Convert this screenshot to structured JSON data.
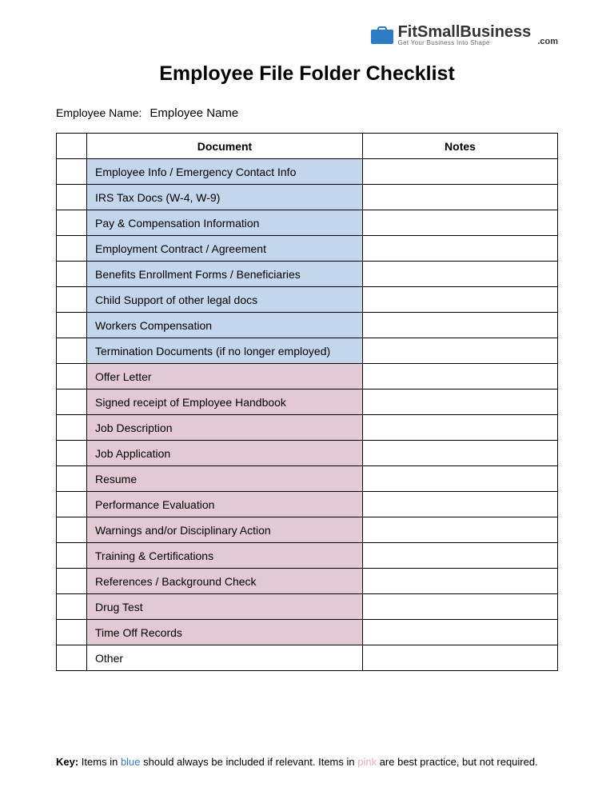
{
  "logo": {
    "brand_fit": "Fit",
    "brand_small": "Small",
    "brand_business": "Business",
    "tagline": "Get Your Business Into Shape",
    "dotcom": ".com"
  },
  "title": "Employee File Folder Checklist",
  "employee_name_label": "Employee Name:",
  "employee_name_value": "Employee Name",
  "headers": {
    "document": "Document",
    "notes": "Notes"
  },
  "rows": [
    {
      "doc": "Employee Info / Emergency Contact Info",
      "color": "blue"
    },
    {
      "doc": "IRS Tax Docs (W-4, W-9)",
      "color": "blue"
    },
    {
      "doc": "Pay & Compensation Information",
      "color": "blue"
    },
    {
      "doc": "Employment Contract / Agreement",
      "color": "blue"
    },
    {
      "doc": "Benefits Enrollment Forms / Beneficiaries",
      "color": "blue"
    },
    {
      "doc": "Child Support of other legal docs",
      "color": "blue"
    },
    {
      "doc": "Workers Compensation",
      "color": "blue"
    },
    {
      "doc": "Termination Documents (if no longer employed)",
      "color": "blue"
    },
    {
      "doc": "Offer Letter",
      "color": "pink"
    },
    {
      "doc": "Signed receipt of Employee Handbook",
      "color": "pink"
    },
    {
      "doc": "Job Description",
      "color": "pink"
    },
    {
      "doc": "Job Application",
      "color": "pink"
    },
    {
      "doc": "Resume",
      "color": "pink"
    },
    {
      "doc": "Performance Evaluation",
      "color": "pink"
    },
    {
      "doc": "Warnings and/or Disciplinary Action",
      "color": "pink"
    },
    {
      "doc": "Training & Certifications",
      "color": "pink"
    },
    {
      "doc": "References / Background Check",
      "color": "pink"
    },
    {
      "doc": "Drug Test",
      "color": "pink"
    },
    {
      "doc": "Time Off Records",
      "color": "pink"
    },
    {
      "doc": "Other",
      "color": "none"
    }
  ],
  "key": {
    "label": "Key:",
    "pre_blue": " Items in ",
    "blue": "blue",
    "post_blue": " should always be included if relevant. Items in ",
    "pink": "pink",
    "post_pink": " are best practice, but not required."
  }
}
